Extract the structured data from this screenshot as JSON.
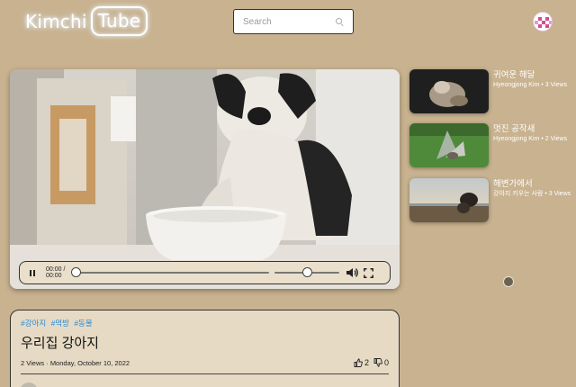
{
  "header": {
    "logo_left": "Kimchi",
    "logo_right": "Tube",
    "search_placeholder": "Search"
  },
  "player": {
    "time_current": "00:00",
    "time_separator": " /",
    "time_total": "00:00",
    "progress": 0.0,
    "volume": 0.5
  },
  "related": [
    {
      "title": "귀여운 해달",
      "meta": "Hyeongjong Kim • 3 Views"
    },
    {
      "title": "멋진 공작새",
      "meta": "Hyeongjong Kim • 2 Views"
    },
    {
      "title": "해변가에서",
      "meta": "강아지 키우는 사람 • 3 Views"
    }
  ],
  "video": {
    "tags": [
      "#강아지",
      "#먹방",
      "#동물"
    ],
    "title": "우리집 강아지",
    "views": "2 Views",
    "separator": " · ",
    "date": "Monday, October 10, 2022",
    "likes": "2",
    "dislikes": "0"
  },
  "colors": {
    "background": "#c8b28f",
    "card": "#e6dac4",
    "controls": "#eadfcb",
    "tag": "#2d8bd6"
  }
}
